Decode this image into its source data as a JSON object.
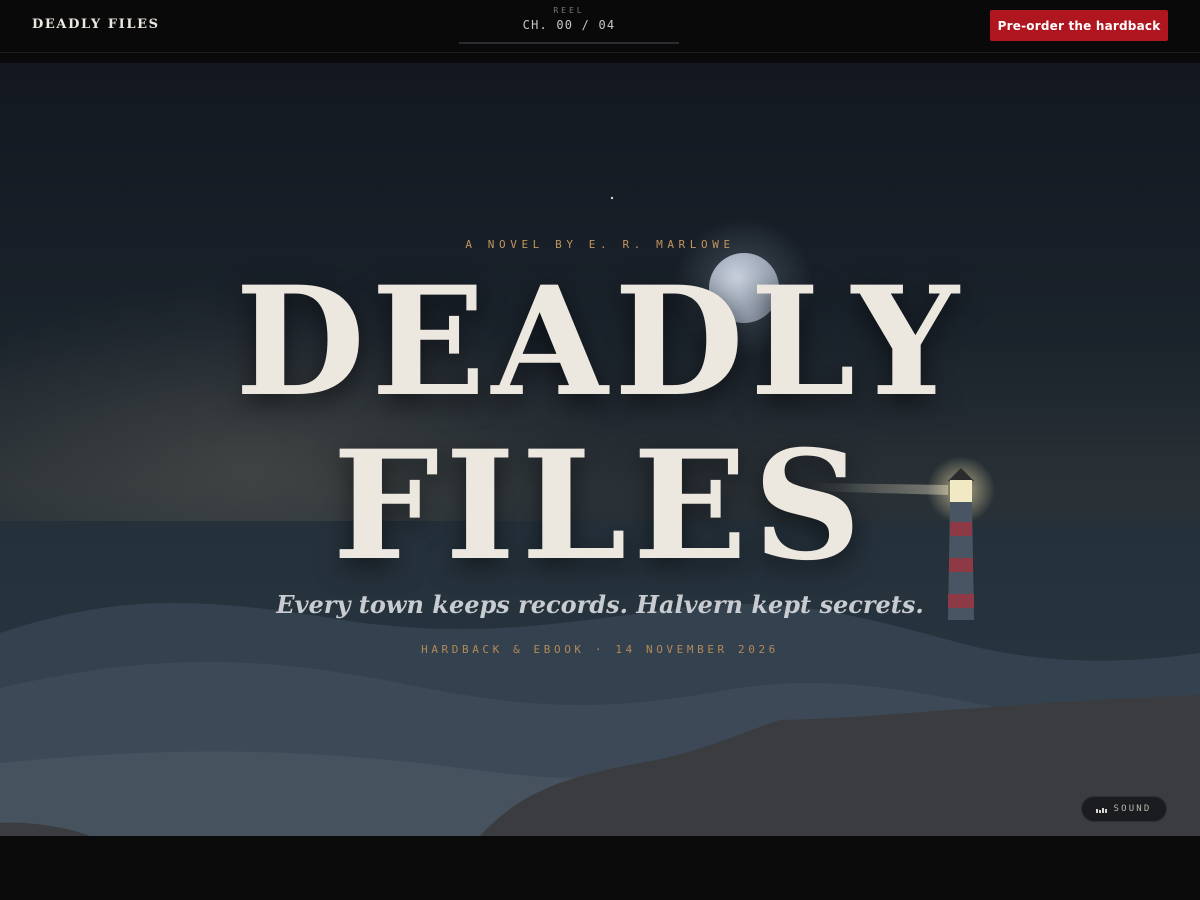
{
  "nav": {
    "brand": "DEADLY FILES",
    "reel_label": "REEL",
    "reel_chapter": "CH. 00 / 04",
    "preorder_label": "Pre-order the hardback"
  },
  "hero": {
    "byline": "A NOVEL BY E. R. MARLOWE",
    "title_line1": "DEADLY",
    "title_line2": "FILES",
    "tagline": "Every town keeps records. Halvern kept secrets.",
    "release": "HARDBACK & EBOOK · 14 NOVEMBER 2026"
  },
  "sound": {
    "label": "SOUND",
    "icon": "sound-bars-icon"
  },
  "colors": {
    "accent": "#b0161f",
    "gold": "#c1955e",
    "title": "#ece8df"
  }
}
